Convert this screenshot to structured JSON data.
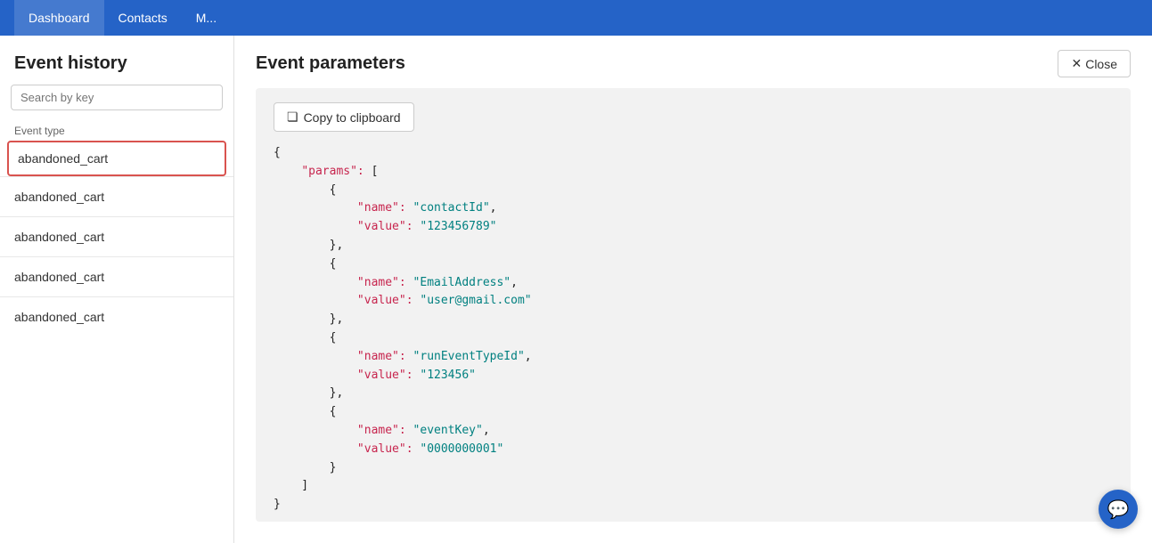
{
  "nav": {
    "items": [
      {
        "label": "Dashboard",
        "active": true
      },
      {
        "label": "Contacts",
        "active": false
      },
      {
        "label": "M...",
        "active": false
      }
    ]
  },
  "sidebar": {
    "title": "Event history",
    "search_placeholder": "Search by key",
    "filter_label": "Event type",
    "list_items": [
      {
        "label": "abandoned_cart",
        "selected": true
      },
      {
        "label": "abandoned_cart",
        "selected": false
      },
      {
        "label": "abandoned_cart",
        "selected": false
      },
      {
        "label": "abandoned_cart",
        "selected": false
      },
      {
        "label": "abandoned_cart",
        "selected": false
      }
    ]
  },
  "modal": {
    "title": "Event parameters",
    "close_label": "Close",
    "copy_label": "Copy to clipboard",
    "json_content": "{\n    \"params\": [\n        {\n            \"name\": \"contactId\",\n            \"value\": \"123456789\"\n        },\n        {\n            \"name\": \"EmailAddress\",\n            \"value\": \"user@gmail.com\"\n        },\n        {\n            \"name\": \"runEventTypeId\",\n            \"value\": \"123456\"\n        },\n        {\n            \"name\": \"eventKey\",\n            \"value\": \"0000000001\"\n        }\n    ]\n}"
  },
  "icons": {
    "close": "✕",
    "copy": "❏",
    "chat": "💬"
  }
}
